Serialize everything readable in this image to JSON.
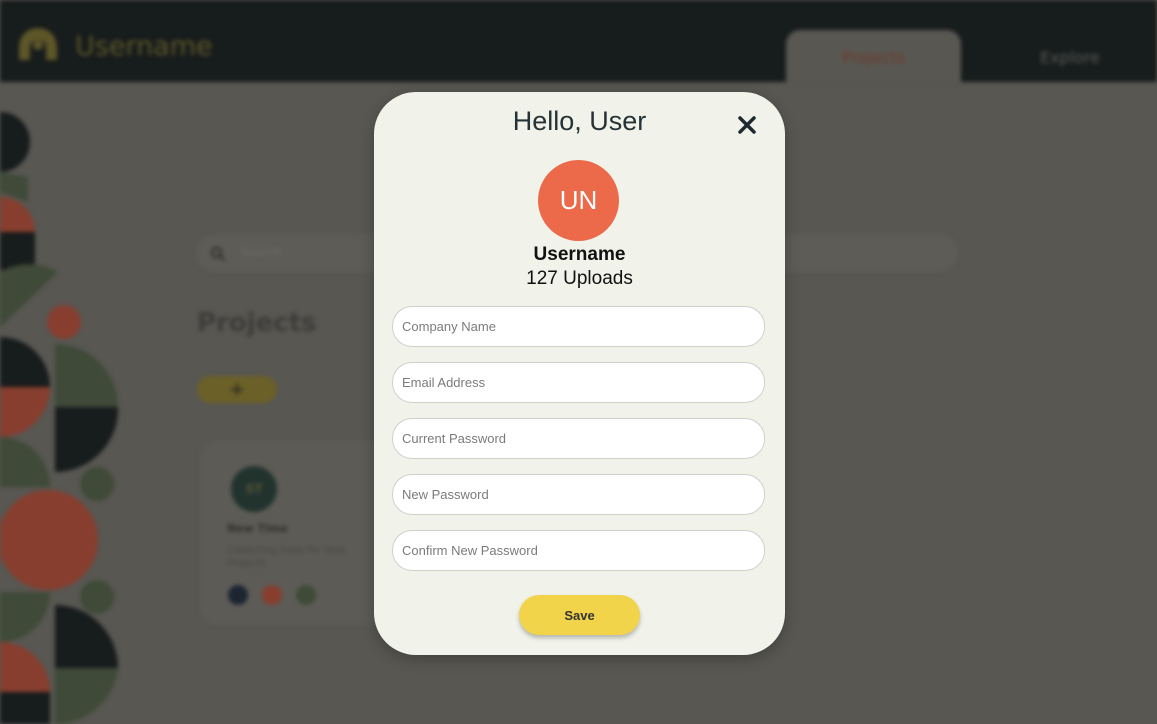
{
  "header": {
    "brand": "Username",
    "tabs": [
      "Projects",
      "Explore"
    ]
  },
  "background": {
    "search_placeholder": "Search",
    "projects_title": "Projects",
    "add_label": "+",
    "card": {
      "avatar_initials": "ST",
      "title": "New Time",
      "description": "Collecting Data for New Projects"
    }
  },
  "modal": {
    "title": "Hello, User",
    "close_icon": "close-icon",
    "avatar_initials": "UN",
    "username": "Username",
    "uploads": "127 Uploads",
    "fields": {
      "company": "Company Name",
      "email": "Email Address",
      "current_password": "Current Password",
      "new_password": "New Password",
      "confirm_password": "Confirm New Password"
    },
    "save_label": "Save"
  },
  "colors": {
    "accent_orange": "#ec6a4a",
    "accent_yellow": "#f2d44b",
    "dark": "#171c1c",
    "green": "#3f4a38",
    "modal_bg": "#f1f3ea"
  }
}
